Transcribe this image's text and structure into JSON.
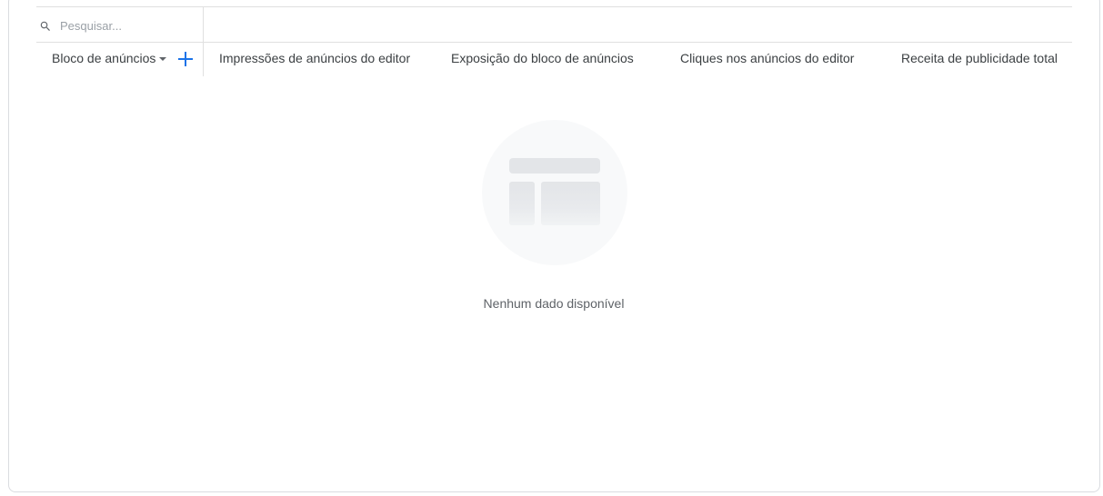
{
  "search": {
    "placeholder": "Pesquisar...",
    "value": "",
    "icon": "search-icon"
  },
  "table": {
    "dimension_header": "Bloco de anúncios",
    "add_dimension_icon": "add-icon",
    "metric_headers": [
      "Impressões de anúncios do editor",
      "Exposição do bloco de anúncios",
      "Cliques nos anúncios do editor",
      "Receita de publicidade total"
    ]
  },
  "empty_state": {
    "message": "Nenhum dado disponível",
    "icon": "empty-table-icon"
  },
  "colors": {
    "accent": "#1a73e8",
    "border": "#e0e0e0",
    "text": "#3c4043",
    "muted": "#5f6368"
  }
}
